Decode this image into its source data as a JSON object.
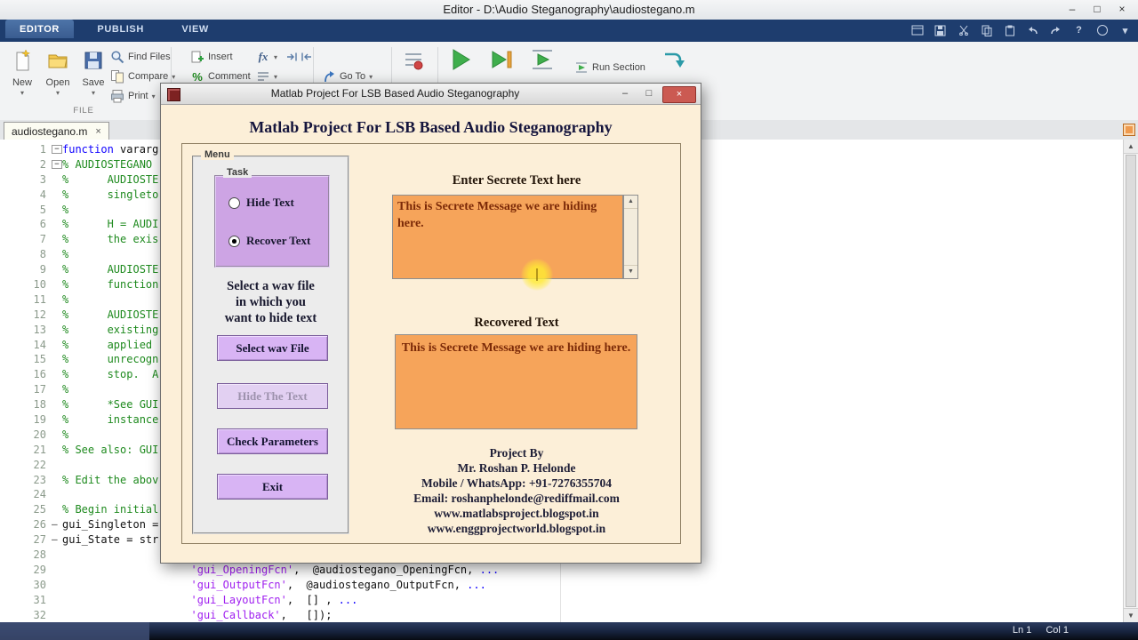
{
  "titlebar": {
    "title": "Editor - D:\\Audio Steganography\\audiostegano.m"
  },
  "icons": {
    "minimize": "–",
    "restore": "□",
    "close": "×",
    "tab_close": "×",
    "dropdown": "▾",
    "percent": "%",
    "help": "?",
    "up_arrow": "▲",
    "down_arrow": "▼",
    "fold_collapse": "−",
    "exec_dash": "–"
  },
  "ribbon": {
    "tabs": [
      "EDITOR",
      "PUBLISH",
      "VIEW"
    ],
    "file": {
      "new": "New",
      "open": "Open",
      "save": "Save",
      "find_files": "Find Files",
      "compare": "Compare",
      "print": "Print",
      "section_label": "FILE"
    },
    "edit": {
      "insert": "Insert",
      "comment": "Comment",
      "fx": "fx"
    },
    "navigate": {
      "go_to": "Go To"
    },
    "run": {
      "run_section": "Run Section"
    }
  },
  "doc_tab": {
    "name": "audiostegano.m"
  },
  "editor": {
    "lines": [
      {
        "num": "1",
        "fold": true,
        "kw": "function",
        "code": " vararg"
      },
      {
        "num": "2",
        "fold": true,
        "comment": "% AUDIOSTEGANO"
      },
      {
        "num": "3",
        "comment": "%      AUDIOSTE"
      },
      {
        "num": "4",
        "comment": "%      singleto"
      },
      {
        "num": "5",
        "comment": "%"
      },
      {
        "num": "6",
        "comment": "%      H = AUDI"
      },
      {
        "num": "7",
        "comment": "%      the exis"
      },
      {
        "num": "8",
        "comment": "%"
      },
      {
        "num": "9",
        "comment": "%      AUDIOSTE"
      },
      {
        "num": "10",
        "comment": "%      function"
      },
      {
        "num": "11",
        "comment": "%"
      },
      {
        "num": "12",
        "comment": "%      AUDIOSTE"
      },
      {
        "num": "13",
        "comment": "%      existing"
      },
      {
        "num": "14",
        "comment": "%      applied "
      },
      {
        "num": "15",
        "comment": "%      unrecogn"
      },
      {
        "num": "16",
        "comment": "%      stop.  A"
      },
      {
        "num": "17",
        "comment": "%"
      },
      {
        "num": "18",
        "comment": "%      *See GUI"
      },
      {
        "num": "19",
        "comment": "%      instance"
      },
      {
        "num": "20",
        "comment": "%"
      },
      {
        "num": "21",
        "comment": "% See also: GUI"
      },
      {
        "num": "22"
      },
      {
        "num": "23",
        "comment": "% Edit the abov"
      },
      {
        "num": "24"
      },
      {
        "num": "25",
        "comment": "% Begin initial"
      },
      {
        "num": "26",
        "dash": true,
        "code": "gui_Singleton = "
      },
      {
        "num": "27",
        "dash": true,
        "code": "gui_State = str"
      },
      {
        "num": "28"
      },
      {
        "num": "29",
        "indent": "                    ",
        "str": "'gui_OpeningFcn'",
        "code": ",  @audiostegano_OpeningFcn, ",
        "cont": "..."
      },
      {
        "num": "30",
        "indent": "                    ",
        "str": "'gui_OutputFcn'",
        "code": ",  @audiostegano_OutputFcn, ",
        "cont": "..."
      },
      {
        "num": "31",
        "indent": "                    ",
        "str": "'gui_LayoutFcn'",
        "code": ",  [] , ",
        "cont": "..."
      },
      {
        "num": "32",
        "indent": "                    ",
        "str": "'gui_Callback'",
        "code": ",   []);"
      }
    ]
  },
  "status": {
    "ln": "Ln 1",
    "col": "Col 1"
  },
  "dialog": {
    "title": "Matlab Project For LSB Based Audio Steganography",
    "heading": "Matlab Project For LSB Based Audio Steganography",
    "menu_label": "Menu",
    "task_label": "Task",
    "radios": [
      {
        "label": "Hide Text",
        "selected": false
      },
      {
        "label": "Recover Text",
        "selected": true
      }
    ],
    "select_file_text": [
      "Select a wav file",
      "in which you",
      "want to hide text"
    ],
    "buttons": {
      "select_wav": "Select wav File",
      "hide_text": "Hide The Text",
      "check_parameters": "Check Parameters",
      "exit": "Exit"
    },
    "secret_label": "Enter Secrete Text here",
    "secret_text": "This is Secrete Message we are hiding here.",
    "recovered_label": "Recovered Text",
    "recovered_text": "This is Secrete Message we are hiding here.",
    "project_info": [
      "Project By",
      "Mr. Roshan P. Helonde",
      "Mobile / WhatsApp: +91-7276355704",
      "Email: roshanphelonde@rediffmail.com",
      "www.matlabsproject.blogspot.in",
      "www.enggprojectworld.blogspot.in"
    ]
  },
  "colors": {
    "ribbon_blue": "#1e3d6e",
    "dialog_bg": "#fcefd8",
    "orange_box": "#f6a45a",
    "violet_button": "#d8b4f4",
    "task_panel": "#cda4e4",
    "run_green": "#3fae4c"
  }
}
